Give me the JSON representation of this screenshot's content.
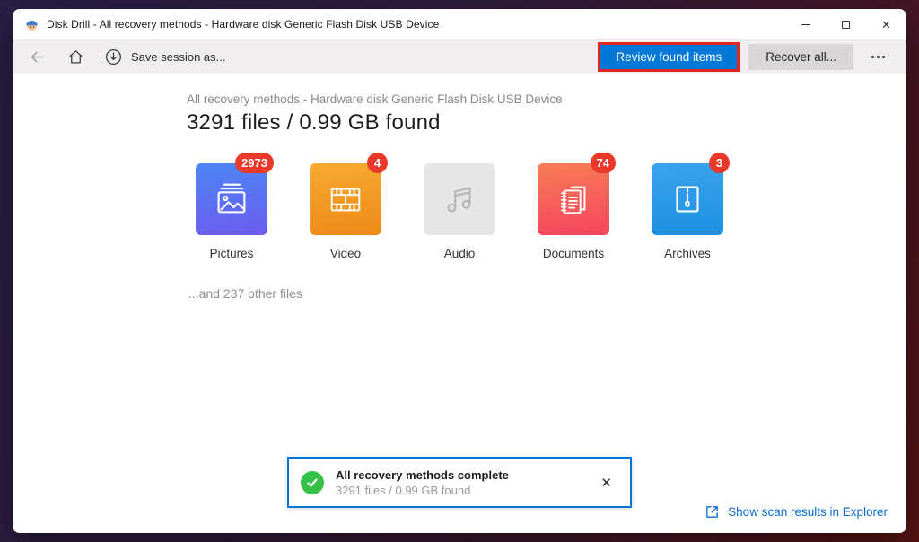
{
  "window": {
    "title": "Disk Drill - All recovery methods - Hardware disk Generic Flash Disk USB Device"
  },
  "icons": {
    "close_glyph": "✕",
    "notif_close_glyph": "✕"
  },
  "toolbar": {
    "save_session_label": "Save session as...",
    "review_button_label": "Review found items",
    "recover_all_label": "Recover all..."
  },
  "main": {
    "subtitle": "All recovery methods - Hardware disk Generic Flash Disk USB Device",
    "heading": "3291 files / 0.99 GB found",
    "other_files": "...and 237 other files",
    "categories": [
      {
        "label": "Pictures",
        "badge": "2973"
      },
      {
        "label": "Video",
        "badge": "4"
      },
      {
        "label": "Audio",
        "badge": ""
      },
      {
        "label": "Documents",
        "badge": "74"
      },
      {
        "label": "Archives",
        "badge": "3"
      }
    ]
  },
  "notification": {
    "title": "All recovery methods complete",
    "subtitle": "3291 files / 0.99 GB found"
  },
  "footer": {
    "explorer_link_label": "Show scan results in Explorer"
  },
  "colors": {
    "accent_blue": "#0078d7",
    "annotation_red": "#e0261c",
    "badge_red": "#ea3829",
    "success_green": "#33c147",
    "tile_pictures": [
      "#4d86f5",
      "#6c5cf0"
    ],
    "tile_video": [
      "#f7aa30",
      "#ee8a17"
    ],
    "tile_audio": "#e7e6e6",
    "tile_documents": [
      "#f87c55",
      "#f5455f"
    ],
    "tile_archives": [
      "#3aa3ed",
      "#1d90e2"
    ],
    "background_gradient": [
      "#2a2047",
      "#591512"
    ]
  }
}
